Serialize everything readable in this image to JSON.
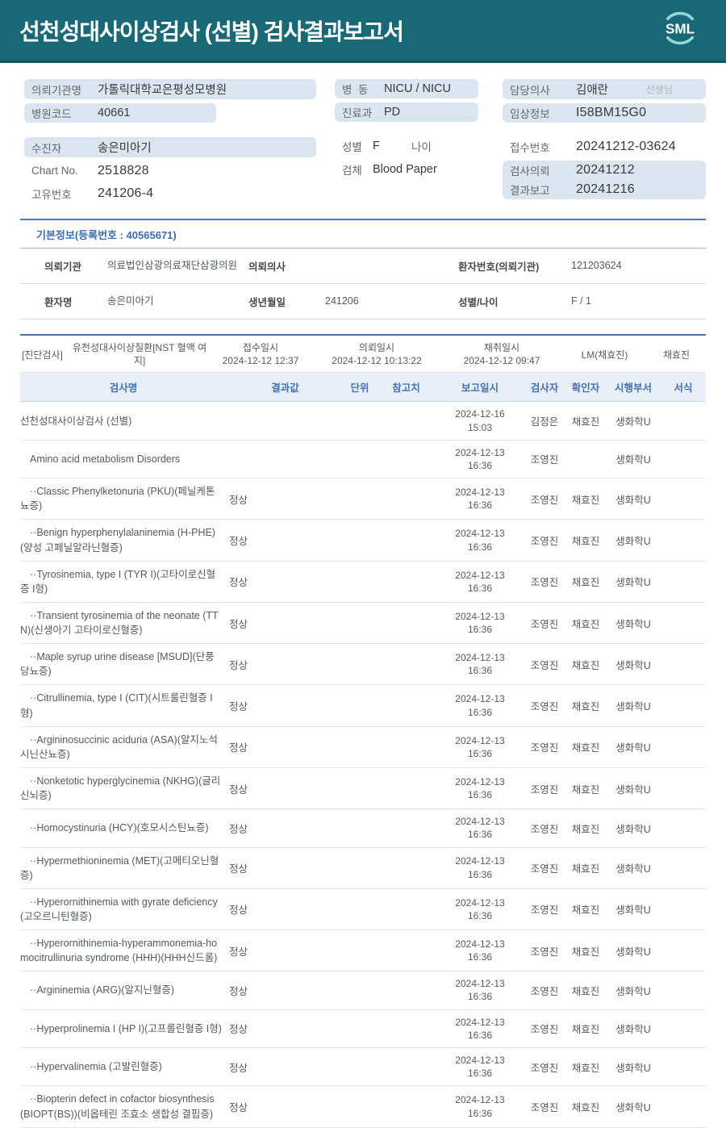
{
  "header": {
    "title": "선천성대사이상검사 (선별) 검사결과보고서",
    "logo_text": "SML"
  },
  "colors": {
    "header_teal": "#186975",
    "header_edge": "#11545e",
    "logo_arc": "#8fd8de",
    "pill_bg": "#dbe5ef",
    "accent_blue": "#4273b3",
    "table_header_bg": "#e9eff6"
  },
  "info": {
    "left": {
      "org_label": "의뢰기관명",
      "org_value": "가톨릭대학교은평성모병원",
      "hospital_code_label": "병원코드",
      "hospital_code_value": "40661",
      "patient_label": "수진자",
      "patient_value": "송은미아기",
      "chart_no_label": "Chart No.",
      "chart_no_value": "2518828",
      "unique_no_label": "고유번호",
      "unique_no_value": "241206-4"
    },
    "middle": {
      "ward_label": "병  동",
      "ward_value": "NICU / NICU",
      "dept_label": "진료과",
      "dept_value": "PD",
      "sex_label": "성별",
      "sex_value": "F",
      "age_label": "나이",
      "age_value": "",
      "specimen_label": "검체",
      "specimen_value": "Blood Paper"
    },
    "right": {
      "doctor_label": "담당의사",
      "doctor_value": "김애란",
      "doctor_suffix": "선생님",
      "clinical_label": "임상정보",
      "clinical_value": "I58BM15G0",
      "receipt_label": "접수번호",
      "receipt_value": "20241212-03624",
      "request_label": "검사의뢰",
      "request_value": "20241212",
      "report_label": "결과보고",
      "report_value": "20241216"
    }
  },
  "basic_info": {
    "title": "기본정보(등록번호 : 40565671)",
    "rows": [
      {
        "c1l": "의뢰기관",
        "c1v": "의료법인삼광의료재단삼광의원",
        "c2l": "의뢰의사",
        "c2v": "",
        "c3l": "환자번호(의뢰기관)",
        "c3v": "121203624"
      },
      {
        "c1l": "환자명",
        "c1v": "송은미아기",
        "c2l": "생년월일",
        "c2v": "241206",
        "c3l": "성별/나이",
        "c3v": "F / 1"
      }
    ]
  },
  "diagnosis": {
    "tag": "[진단검사]",
    "test_group": "유전성대사이상질환[NST 혈액 여지]",
    "receipt_label": "접수일시",
    "receipt_time": "2024-12-12 12:37",
    "request_label": "의뢰일시",
    "request_time": "2024-12-12 10:13:22",
    "collect_label": "채취일시",
    "collect_time": "2024-12-12 09:47",
    "collector": "LM(채효진)",
    "collector2": "채효진"
  },
  "table": {
    "headers": [
      "검사명",
      "결과값",
      "단위",
      "참고치",
      "보고일시",
      "검사자",
      "확인자",
      "시행부서",
      "서식"
    ],
    "rows": [
      {
        "name": "선천성대사이상검사 (선별)",
        "level": 0,
        "result": "",
        "date": "2024-12-16",
        "time": "15:03",
        "tester": "김정은",
        "verifier": "채효진",
        "dept": "생화학U"
      },
      {
        "name": "Amino acid metabolism Disorders",
        "level": 1,
        "result": "",
        "date": "2024-12-13",
        "time": "16:36",
        "tester": "조영진",
        "verifier": "",
        "dept": "생화학U"
      },
      {
        "name": "··Classic Phenylketonuria (PKU)(페닐케톤뇨증)",
        "level": 1,
        "result": "정상",
        "date": "2024-12-13",
        "time": "16:36",
        "tester": "조영진",
        "verifier": "채효진",
        "dept": "생화학U"
      },
      {
        "name": "··Benign hyperphenylalaninemia (H-PHE)(양성 고페닐알라닌혈증)",
        "level": 1,
        "result": "정상",
        "date": "2024-12-13",
        "time": "16:36",
        "tester": "조영진",
        "verifier": "채효진",
        "dept": "생화학U"
      },
      {
        "name": "··Tyrosinemia, type I (TYR I)(고타이로신혈증 I형)",
        "level": 1,
        "result": "정상",
        "date": "2024-12-13",
        "time": "16:36",
        "tester": "조영진",
        "verifier": "채효진",
        "dept": "생화학U"
      },
      {
        "name": "··Transient tyrosinemia of the neonate (TTN)(신생아기 고타이로신혈증)",
        "level": 1,
        "result": "정상",
        "date": "2024-12-13",
        "time": "16:36",
        "tester": "조영진",
        "verifier": "채효진",
        "dept": "생화학U"
      },
      {
        "name": "··Maple syrup urine disease [MSUD](단풍당뇨증)",
        "level": 1,
        "result": "정상",
        "date": "2024-12-13",
        "time": "16:36",
        "tester": "조영진",
        "verifier": "채효진",
        "dept": "생화학U"
      },
      {
        "name": "··Citrullinemia, type I (CIT)(시트룰린혈증 I형)",
        "level": 1,
        "result": "정상",
        "date": "2024-12-13",
        "time": "16:36",
        "tester": "조영진",
        "verifier": "채효진",
        "dept": "생화학U"
      },
      {
        "name": "··Argininosuccinic aciduria (ASA)(알지노석시닌산뇨증)",
        "level": 1,
        "result": "정상",
        "date": "2024-12-13",
        "time": "16:36",
        "tester": "조영진",
        "verifier": "채효진",
        "dept": "생화학U"
      },
      {
        "name": "··Nonketotic hyperglycinemia (NKHG)(글리신뇌증)",
        "level": 1,
        "result": "정상",
        "date": "2024-12-13",
        "time": "16:36",
        "tester": "조영진",
        "verifier": "채효진",
        "dept": "생화학U"
      },
      {
        "name": "··Homocystinuria (HCY)(호모시스틴뇨증)",
        "level": 1,
        "result": "정상",
        "date": "2024-12-13",
        "time": "16:36",
        "tester": "조영진",
        "verifier": "채효진",
        "dept": "생화학U"
      },
      {
        "name": "··Hypermethioninemia (MET)(고메티오닌혈증)",
        "level": 1,
        "result": "정상",
        "date": "2024-12-13",
        "time": "16:36",
        "tester": "조영진",
        "verifier": "채효진",
        "dept": "생화학U"
      },
      {
        "name": "··Hyperornithinemia with gyrate deficiency(고오르니틴혈증)",
        "level": 1,
        "result": "정상",
        "date": "2024-12-13",
        "time": "16:36",
        "tester": "조영진",
        "verifier": "채효진",
        "dept": "생화학U"
      },
      {
        "name": "··Hyperornithinemia-hyperammonemia-homocitrullinuria syndrome (HHH)(HHH신드롬)",
        "level": 1,
        "result": "정상",
        "date": "2024-12-13",
        "time": "16:36",
        "tester": "조영진",
        "verifier": "채효진",
        "dept": "생화학U"
      },
      {
        "name": "··Argininemia (ARG)(알지닌혈증)",
        "level": 1,
        "result": "정상",
        "date": "2024-12-13",
        "time": "16:36",
        "tester": "조영진",
        "verifier": "채효진",
        "dept": "생화학U"
      },
      {
        "name": "··Hyperprolinemia I (HP I)(고프롤린혈증 I형)",
        "level": 1,
        "result": "정상",
        "date": "2024-12-13",
        "time": "16:36",
        "tester": "조영진",
        "verifier": "채효진",
        "dept": "생화학U"
      },
      {
        "name": "··Hypervalinemia (고발린혈증)",
        "level": 1,
        "result": "정상",
        "date": "2024-12-13",
        "time": "16:36",
        "tester": "조영진",
        "verifier": "채효진",
        "dept": "생화학U"
      },
      {
        "name": "··Biopterin defect in cofactor biosynthesis (BIOPT(BS))(비옵테린 조효소 생합성 결핍증)",
        "level": 1,
        "result": "정상",
        "date": "2024-12-13",
        "time": "16:36",
        "tester": "조영진",
        "verifier": "채효진",
        "dept": "생화학U"
      }
    ]
  }
}
